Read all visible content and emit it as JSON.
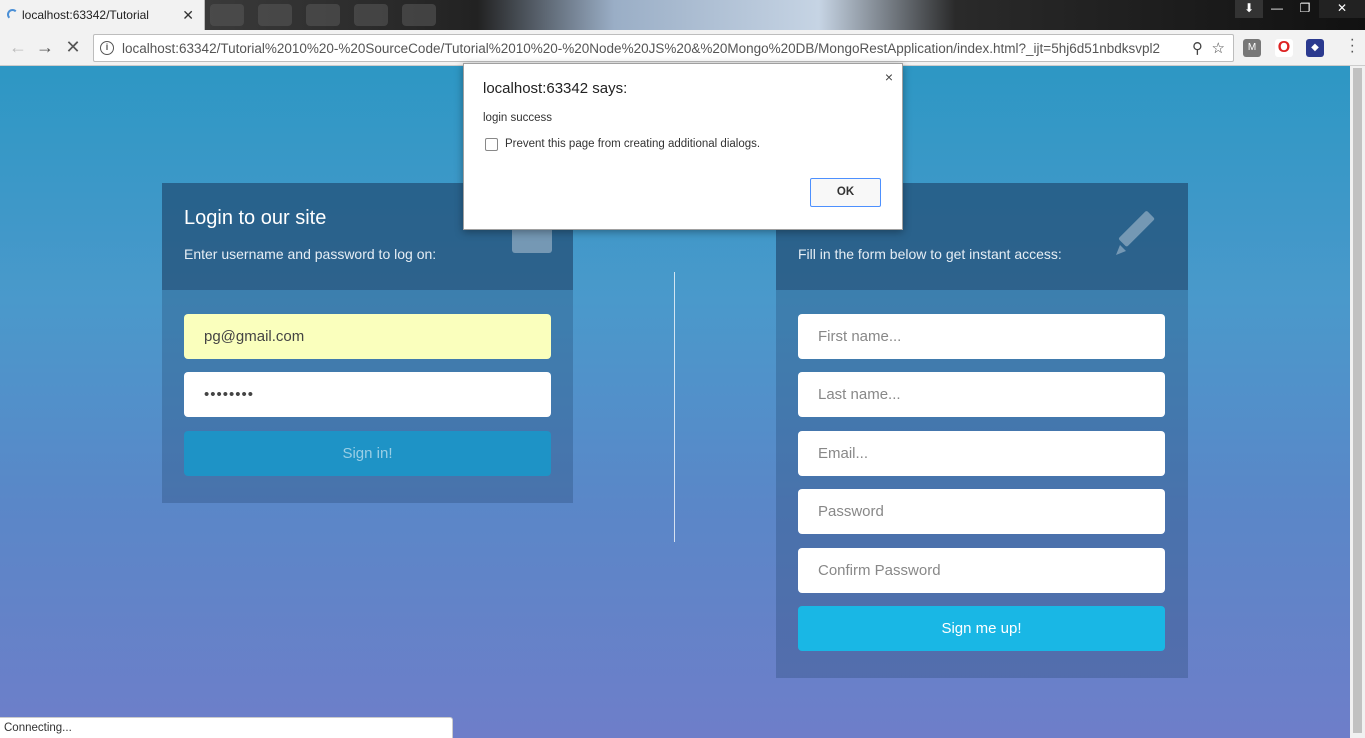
{
  "browser": {
    "tab_title": "localhost:63342/Tutorial",
    "url": "localhost:63342/Tutorial%2010%20-%20SourceCode/Tutorial%2010%20-%20Node%20JS%20&%20Mongo%20DB/MongoRestApplication/index.html?_ijt=5hj6d51nbdksvpl2",
    "status_text": "Connecting..."
  },
  "login": {
    "title": "Login to our site",
    "subtitle": "Enter username and password to log on:",
    "username_value": "pg@gmail.com",
    "password_value": "••••••••",
    "signin_label": "Sign in!"
  },
  "register": {
    "subtitle": "Fill in the form below to get instant access:",
    "first_name_placeholder": "First name...",
    "last_name_placeholder": "Last name...",
    "email_placeholder": "Email...",
    "password_placeholder": "Password",
    "confirm_placeholder": "Confirm Password",
    "signup_label": "Sign me up!"
  },
  "dialog": {
    "title": "localhost:63342 says:",
    "message": "login success",
    "checkbox_label": "Prevent this page from creating additional dialogs.",
    "ok_label": "OK",
    "close_label": "×"
  },
  "colors": {
    "signin_button": "#1e93c6",
    "signup_button": "#19b7e5",
    "autofill": "#faffbd"
  }
}
